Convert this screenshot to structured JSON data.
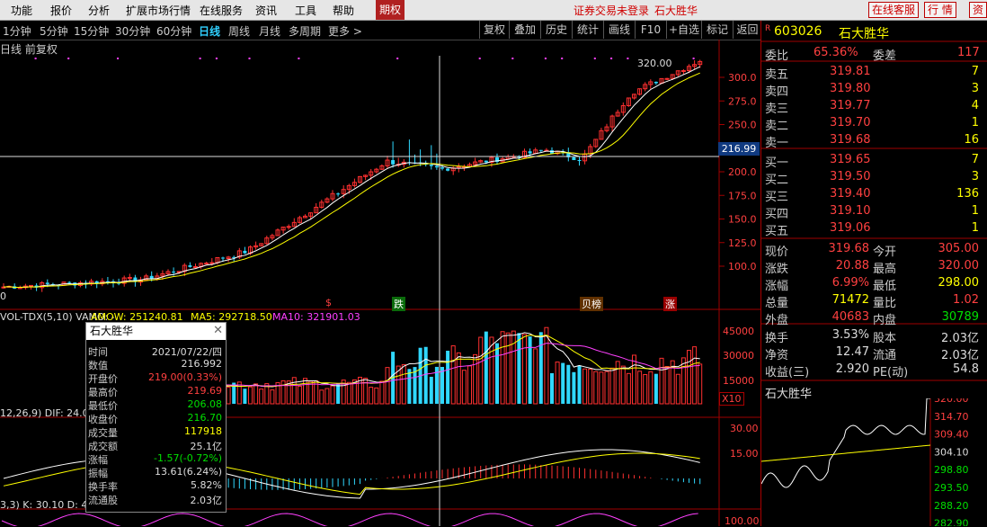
{
  "menu": {
    "items": [
      "功能",
      "报价",
      "分析",
      "扩展市场行情",
      "在线服务",
      "资讯",
      "工具",
      "帮助"
    ],
    "period_tab": "期权",
    "status_text": "证券交易未登录",
    "stock_name": "石大胜华",
    "online_service_button": "在线客服",
    "quote_button": "行  情",
    "info_button": "资"
  },
  "toolbar": {
    "periods": [
      "1分钟",
      "5分钟",
      "15分钟",
      "30分钟",
      "60分钟",
      "日线",
      "周线",
      "月线",
      "多周期",
      "更多 >"
    ],
    "active_period": "日线",
    "buttons": [
      "复权",
      "叠加",
      "历史",
      "统计",
      "画线",
      "F10",
      "+自选",
      "标记",
      "返回"
    ]
  },
  "chart": {
    "title": "日线 前复权",
    "price_ticks": [
      "300.0",
      "275.0",
      "250.0",
      "225.0",
      "200.0",
      "175.0",
      "150.0",
      "125.0",
      "100.0"
    ],
    "high_label": "320.00",
    "crosshair_label": "216.99",
    "low_label": "0",
    "event_labels": [
      "$",
      "跌",
      "贝榜",
      "涨"
    ],
    "volume_label": "VOL-TDX(5,10) VAMO: -",
    "amow_label": "AMOW: 251240.81",
    "ma5_label": "MA5: 292718.50",
    "ma10_label": "MA10: 321901.03",
    "volume_ticks": [
      "45000",
      "30000",
      "15000"
    ],
    "volume_unit": "X10",
    "macd_label": "12,26,9) DIF: 24.0",
    "macd_ticks": [
      "30.00",
      "15.00"
    ],
    "kdj_label": "3,3) K: 30.10 D: 4",
    "kdj_tick": "100.00",
    "candle_colors": {
      "up": "#ff3030",
      "down": "#30d8ff",
      "ma5": "#ffffff",
      "ma10": "#ffff00",
      "ma_volume": "#ff40ff"
    }
  },
  "tooltip": {
    "title": "石大胜华",
    "rows": [
      {
        "k": "时间",
        "v": "2021/07/22/四",
        "c": "white"
      },
      {
        "k": "数值",
        "v": "216.992",
        "c": "white"
      },
      {
        "k": "开盘价",
        "v": "219.00(0.33%)",
        "c": "red"
      },
      {
        "k": "最高价",
        "v": "219.69",
        "c": "red"
      },
      {
        "k": "最低价",
        "v": "206.08",
        "c": "green"
      },
      {
        "k": "收盘价",
        "v": "216.70",
        "c": "green"
      },
      {
        "k": "成交量",
        "v": "117918",
        "c": "yellow"
      },
      {
        "k": "成交额",
        "v": "25.1亿",
        "c": "white"
      },
      {
        "k": "涨幅",
        "v": "-1.57(-0.72%)",
        "c": "green"
      },
      {
        "k": "振幅",
        "v": "13.61(6.24%)",
        "c": "white"
      },
      {
        "k": "换手率",
        "v": "5.82%",
        "c": "white"
      },
      {
        "k": "流通股",
        "v": "2.03亿",
        "c": "white"
      }
    ]
  },
  "quote": {
    "code": "603026",
    "name": "石大胜华",
    "weibi_label": "委比",
    "weibi": "65.36%",
    "weicha_label": "委差",
    "weicha": "117",
    "sell": [
      {
        "label": "卖五",
        "price": "319.81",
        "vol": "7"
      },
      {
        "label": "卖四",
        "price": "319.80",
        "vol": "3"
      },
      {
        "label": "卖三",
        "price": "319.77",
        "vol": "4"
      },
      {
        "label": "卖二",
        "price": "319.70",
        "vol": "1"
      },
      {
        "label": "卖一",
        "price": "319.68",
        "vol": "16"
      }
    ],
    "buy": [
      {
        "label": "买一",
        "price": "319.65",
        "vol": "7"
      },
      {
        "label": "买二",
        "price": "319.50",
        "vol": "3"
      },
      {
        "label": "买三",
        "price": "319.40",
        "vol": "136"
      },
      {
        "label": "买四",
        "price": "319.10",
        "vol": "1"
      },
      {
        "label": "买五",
        "price": "319.06",
        "vol": "1"
      }
    ],
    "stats": [
      {
        "l1": "现价",
        "v1": "319.68",
        "c1": "red",
        "l2": "今开",
        "v2": "305.00",
        "c2": "red"
      },
      {
        "l1": "涨跌",
        "v1": "20.88",
        "c1": "red",
        "l2": "最高",
        "v2": "320.00",
        "c2": "red"
      },
      {
        "l1": "涨幅",
        "v1": "6.99%",
        "c1": "red",
        "l2": "最低",
        "v2": "298.00",
        "c2": "yellow"
      },
      {
        "l1": "总量",
        "v1": "71472",
        "c1": "yellow",
        "l2": "量比",
        "v2": "1.02",
        "c2": "red"
      },
      {
        "l1": "外盘",
        "v1": "40683",
        "c1": "red",
        "l2": "内盘",
        "v2": "30789",
        "c2": "green"
      }
    ],
    "info": [
      {
        "l1": "换手",
        "v1": "3.53%",
        "l2": "股本",
        "v2": "2.03亿"
      },
      {
        "l1": "净资",
        "v1": "12.47",
        "l2": "流通",
        "v2": "2.03亿"
      },
      {
        "l1": "收益(三)",
        "v1": "2.920",
        "l2": "PE(动)",
        "v2": "54.8"
      }
    ]
  },
  "mini_chart": {
    "title": "石大胜华",
    "ticks": [
      "320.00",
      "314.70",
      "309.40",
      "304.10",
      "298.80",
      "293.50",
      "288.20",
      "282.90"
    ]
  }
}
